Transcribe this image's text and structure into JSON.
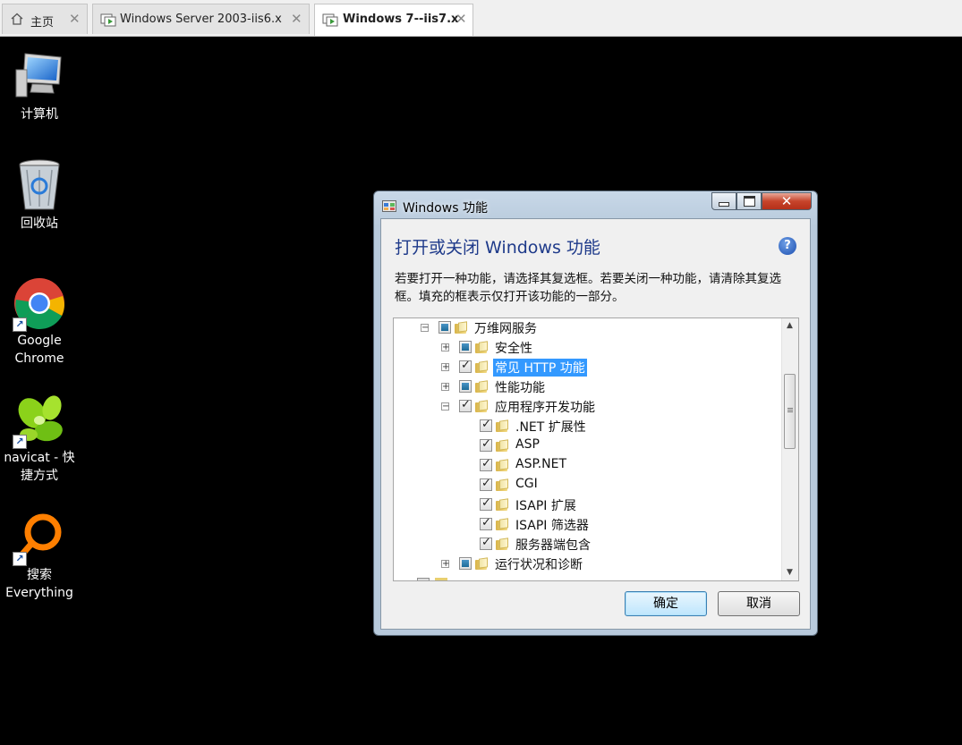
{
  "tabs": [
    {
      "label": "主页",
      "icon": "home-icon"
    },
    {
      "label": "Windows Server 2003-iis6.x",
      "icon": "vm-icon"
    },
    {
      "label": "Windows 7--iis7.x",
      "icon": "vm-icon",
      "active": true
    }
  ],
  "desktop": {
    "icons": [
      {
        "label": "计算机",
        "icon": "computer-icon"
      },
      {
        "label": "回收站",
        "icon": "recycle-bin-icon"
      },
      {
        "label": "Google Chrome",
        "icon": "chrome-icon",
        "shortcut": true
      },
      {
        "label": "navicat - 快捷方式",
        "icon": "navicat-icon",
        "shortcut": true
      },
      {
        "label": "搜索 Everything",
        "icon": "everything-icon",
        "shortcut": true
      }
    ]
  },
  "dialog": {
    "title": "Windows 功能",
    "heading": "打开或关闭 Windows 功能",
    "description": "若要打开一种功能，请选择其复选框。若要关闭一种功能，请清除其复选框。填充的框表示仅打开该功能的一部分。",
    "tree": [
      {
        "label": "万维网服务",
        "level": 0,
        "expander": "minus",
        "check": "partial"
      },
      {
        "label": "安全性",
        "level": 1,
        "expander": "plus",
        "check": "partial"
      },
      {
        "label": "常见 HTTP 功能",
        "level": 1,
        "expander": "plus",
        "check": "checked",
        "selected": true
      },
      {
        "label": "性能功能",
        "level": 1,
        "expander": "plus",
        "check": "partial"
      },
      {
        "label": "应用程序开发功能",
        "level": 1,
        "expander": "minus",
        "check": "checked"
      },
      {
        "label": ".NET 扩展性",
        "level": 2,
        "check": "checked"
      },
      {
        "label": "ASP",
        "level": 2,
        "check": "checked"
      },
      {
        "label": "ASP.NET",
        "level": 2,
        "check": "checked"
      },
      {
        "label": "CGI",
        "level": 2,
        "check": "checked"
      },
      {
        "label": "ISAPI 扩展",
        "level": 2,
        "check": "checked"
      },
      {
        "label": "ISAPI 筛选器",
        "level": 2,
        "check": "checked"
      },
      {
        "label": "服务器端包含",
        "level": 2,
        "check": "checked"
      },
      {
        "label": "运行状况和诊断",
        "level": 1,
        "expander": "plus",
        "check": "partial"
      }
    ],
    "ok_label": "确定",
    "cancel_label": "取消"
  },
  "colors": {
    "desktop_bg": "#000000",
    "heading": "#1e3a8a",
    "selection": "#3399ff",
    "close_button": "#c7442b"
  }
}
